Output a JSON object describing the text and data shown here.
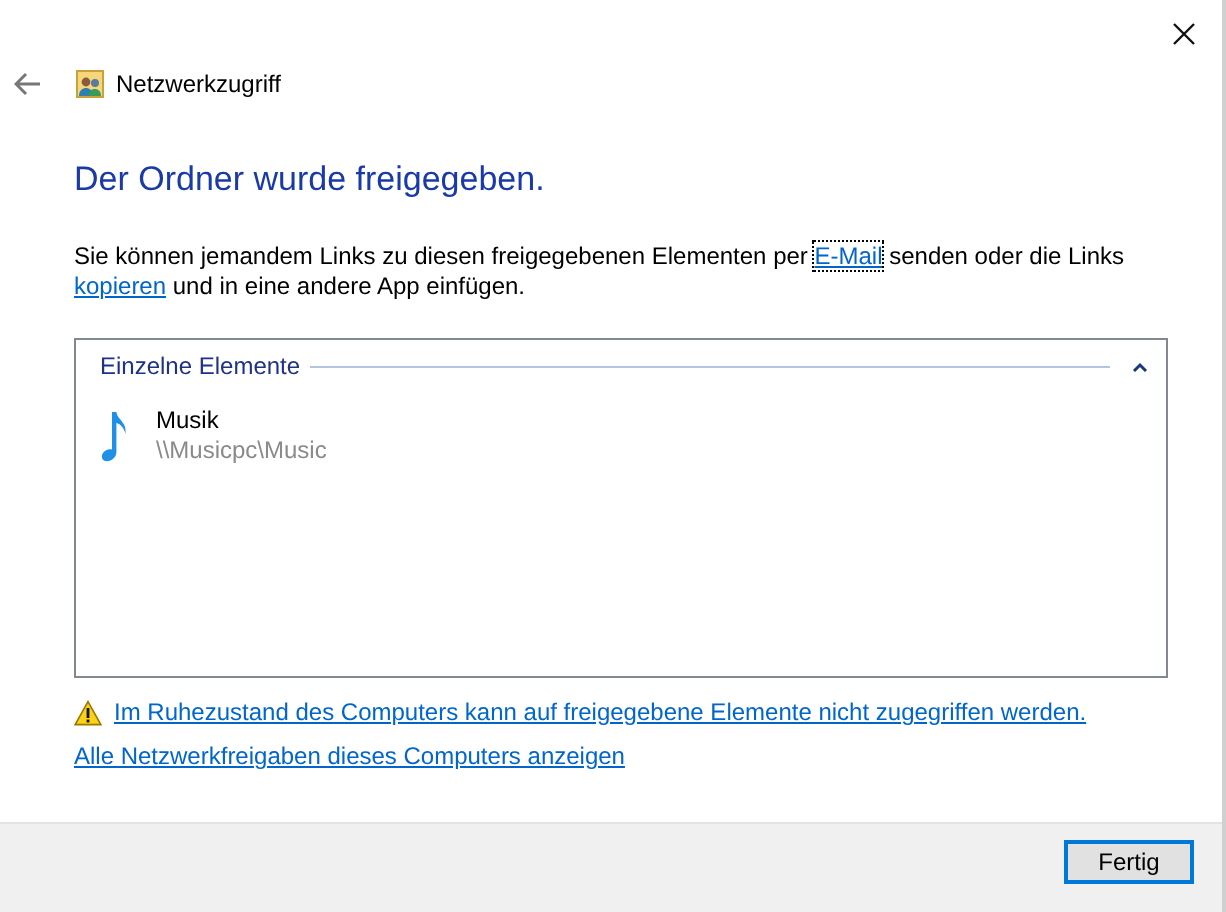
{
  "window": {
    "title": "Netzwerkzugriff"
  },
  "heading": "Der Ordner wurde freigegeben.",
  "description": [
    {
      "kind": "text",
      "text": "Sie können jemandem Links zu diesen freigegebenen Elementen per "
    },
    {
      "kind": "link",
      "text": "E-Mail",
      "focused": true
    },
    {
      "kind": "text",
      "text": " senden oder die Links "
    },
    {
      "kind": "link",
      "text": "kopieren",
      "focused": false
    },
    {
      "kind": "text",
      "text": " und in eine andere App einfügen."
    }
  ],
  "group": {
    "title": "Einzelne Elemente",
    "expanded": true,
    "items": [
      {
        "name": "Musik",
        "path": "\\\\Musicpc\\Music"
      }
    ]
  },
  "warning_link": "Im Ruhezustand des Computers kann auf freigegebene Elemente nicht zugegriffen werden.",
  "shares_link": "Alle Netzwerkfreigaben dieses Computers anzeigen",
  "buttons": [
    "Fertig"
  ]
}
